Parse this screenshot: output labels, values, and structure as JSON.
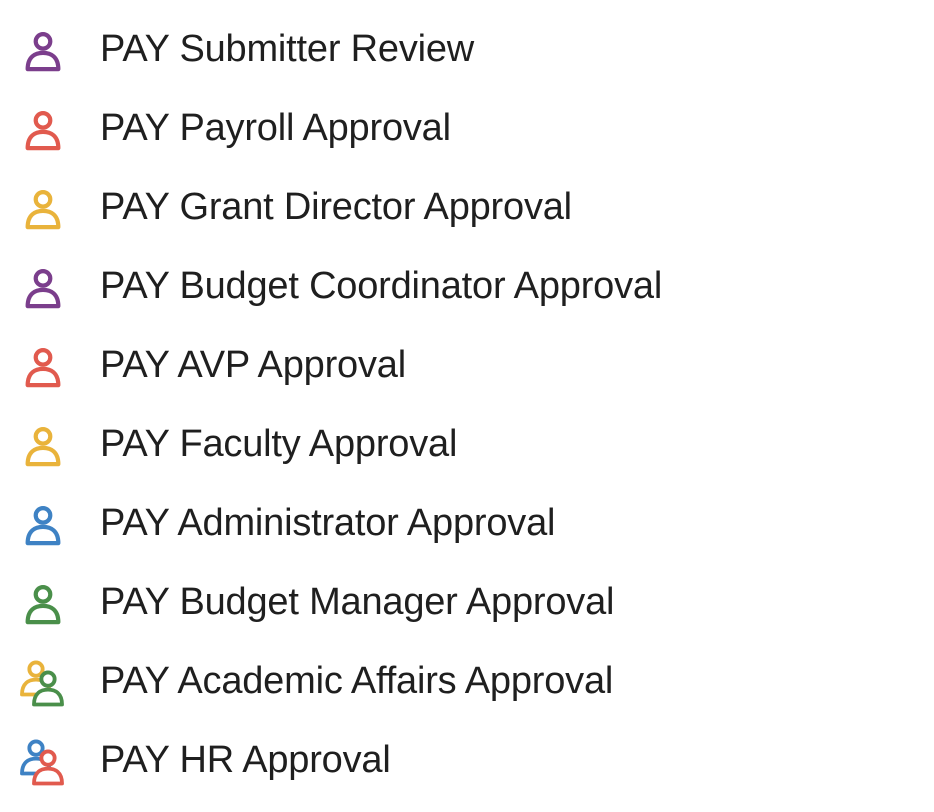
{
  "colors": {
    "purple": "#7b3e8c",
    "red": "#e15a4e",
    "yellow": "#e9b33b",
    "blue": "#3e82c4",
    "green": "#4a8f4a"
  },
  "items": [
    {
      "label": "PAY Submitter Review",
      "icon": "single",
      "c1": "purple"
    },
    {
      "label": "PAY Payroll Approval",
      "icon": "single",
      "c1": "red"
    },
    {
      "label": "PAY Grant Director Approval",
      "icon": "single",
      "c1": "yellow"
    },
    {
      "label": "PAY Budget Coordinator Approval",
      "icon": "single",
      "c1": "purple"
    },
    {
      "label": "PAY AVP Approval",
      "icon": "single",
      "c1": "red"
    },
    {
      "label": "PAY Faculty Approval",
      "icon": "single",
      "c1": "yellow"
    },
    {
      "label": "PAY Administrator Approval",
      "icon": "single",
      "c1": "blue"
    },
    {
      "label": "PAY Budget Manager Approval",
      "icon": "single",
      "c1": "green"
    },
    {
      "label": "PAY Academic Affairs Approval",
      "icon": "double",
      "c1": "yellow",
      "c2": "green"
    },
    {
      "label": "PAY HR Approval",
      "icon": "double",
      "c1": "blue",
      "c2": "red"
    }
  ]
}
